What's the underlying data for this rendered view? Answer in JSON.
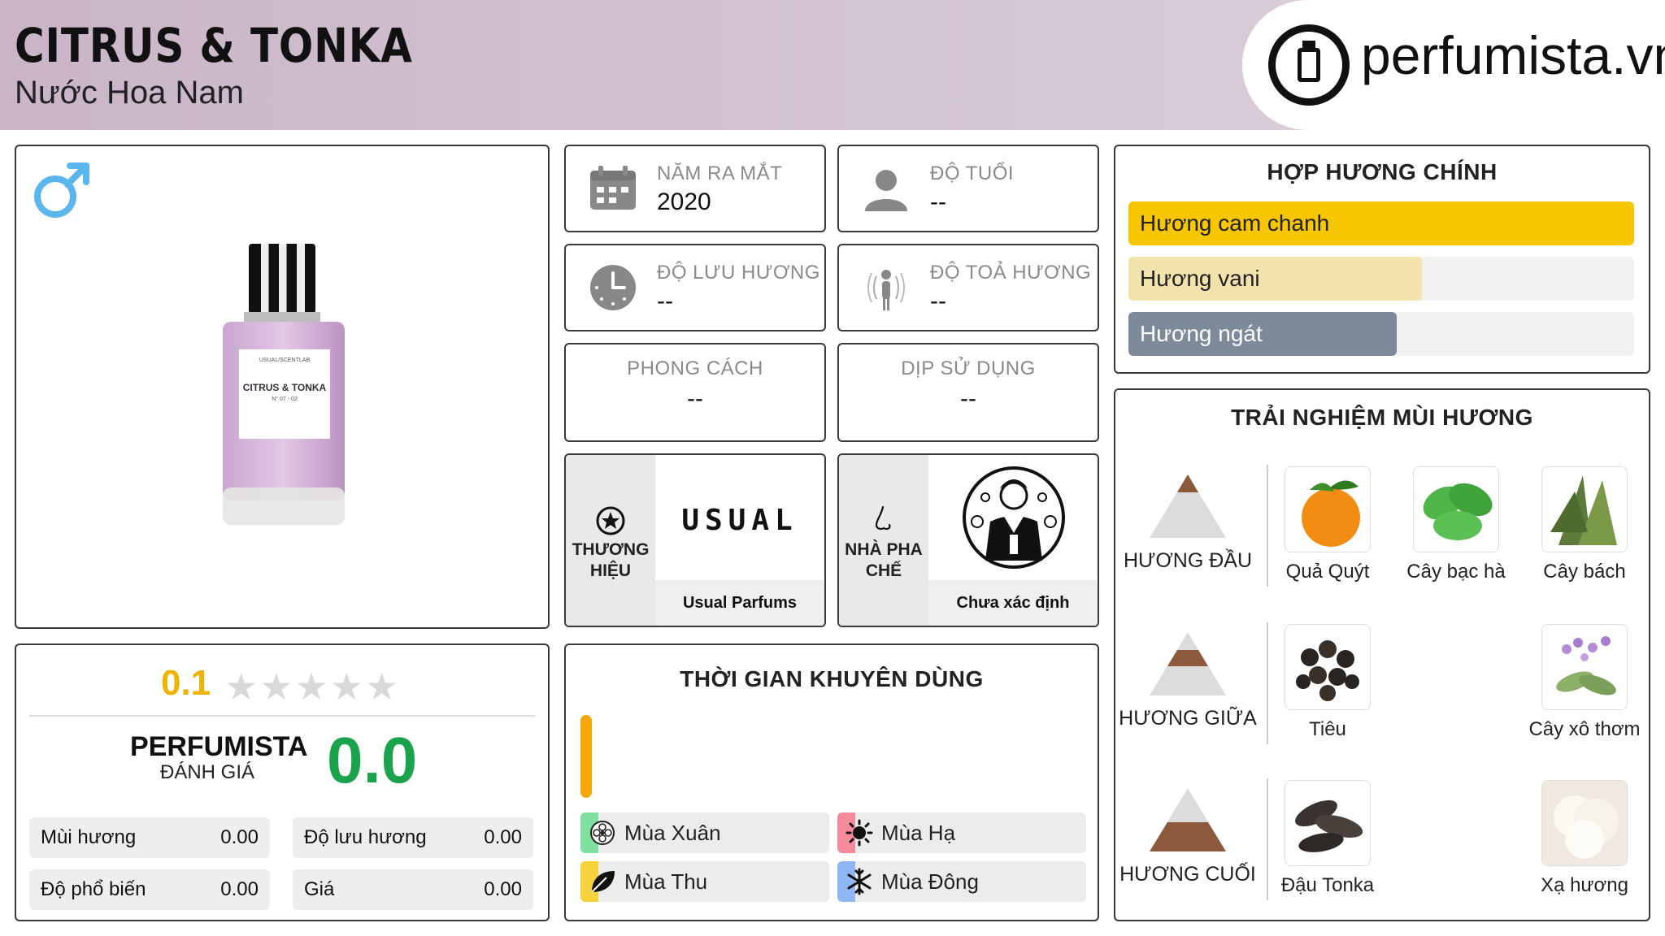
{
  "header": {
    "title": "CITRUS & TONKA",
    "subtitle": "Nước Hoa Nam",
    "logo_text": "perfumista.vn"
  },
  "product": {
    "bottle_label_top": "USUAL/SCENTLAB",
    "bottle_label_name": "CITRUS & TONKA",
    "bottle_label_no": "N° 07 - 02",
    "gender_icon": "male-icon"
  },
  "info": {
    "release_year": {
      "label": "NĂM RA MẮT",
      "value": "2020"
    },
    "age": {
      "label": "ĐỘ TUỔI",
      "value": "--"
    },
    "longevity": {
      "label": "ĐỘ LƯU HƯƠNG",
      "value": "--"
    },
    "sillage": {
      "label": "ĐỘ TOẢ HƯƠNG",
      "value": "--"
    },
    "style": {
      "label": "PHONG CÁCH",
      "value": "--"
    },
    "occasion": {
      "label": "DỊP SỬ DỤNG",
      "value": "--"
    }
  },
  "brand": {
    "label": "THƯƠNG HIỆU",
    "logo_text": "USUAL",
    "name": "Usual Parfums"
  },
  "perfumer": {
    "label": "NHÀ PHA CHẾ",
    "name": "Chưa xác định"
  },
  "accords": {
    "title": "HỢP HƯƠNG CHÍNH",
    "items": [
      {
        "name": "Hương cam chanh",
        "level": 1.0,
        "color": "#f7c600"
      },
      {
        "name": "Hương vani",
        "level": 0.58,
        "color": "#f2e3ad"
      },
      {
        "name": "Hương ngát",
        "level": 0.53,
        "color": "#7d8a99"
      }
    ]
  },
  "notes": {
    "title": "TRẢI NGHIỆM MÙI HƯƠNG",
    "top": {
      "label": "HƯƠNG ĐẦU",
      "items": [
        "Quả Quýt",
        "Cây bạc hà",
        "Cây bách"
      ]
    },
    "middle": {
      "label": "HƯƠNG GIỮA",
      "items": [
        "Tiêu",
        "Cây xô thơm"
      ]
    },
    "base": {
      "label": "HƯƠNG CUỐI",
      "items": [
        "Đậu Tonka",
        "Xạ hương"
      ]
    }
  },
  "rating": {
    "user_score": "0.1",
    "stars_filled_fraction": 0.02,
    "perfumista_label_1": "PERFUMISTA",
    "perfumista_label_2": "ĐÁNH GIÁ",
    "perfumista_score": "0.0",
    "metrics": [
      {
        "name": "Mùi hương",
        "value": "0.00"
      },
      {
        "name": "Độ lưu hương",
        "value": "0.00"
      },
      {
        "name": "Độ phổ biến",
        "value": "0.00"
      },
      {
        "name": "Giá",
        "value": "0.00"
      }
    ]
  },
  "seasons": {
    "title": "THỜI GIAN KHUYÊN DÙNG",
    "items": [
      {
        "name": "Mùa Xuân",
        "color": "#7fe0a0"
      },
      {
        "name": "Mùa Hạ",
        "color": "#f48a9a"
      },
      {
        "name": "Mùa Thu",
        "color": "#f7d23a"
      },
      {
        "name": "Mùa Đông",
        "color": "#8fb6f2"
      }
    ]
  }
}
